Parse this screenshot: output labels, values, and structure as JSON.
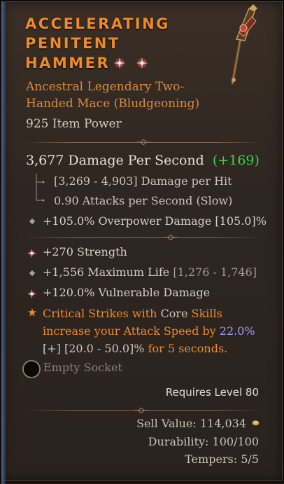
{
  "item": {
    "name_lines": [
      "Accelerating",
      "Penitent",
      "Hammer"
    ],
    "subtitle_lines": [
      "Ancestral Legendary Two-",
      "Handed Mace (Bludgeoning)"
    ],
    "item_power": "925 Item Power"
  },
  "damage": {
    "dps": "3,677 Damage Per Second",
    "dps_delta": "(+169)",
    "per_hit": "[3,269 - 4,903] Damage per Hit",
    "attacks": "0.90 Attacks per Second (Slow)",
    "overpower": "+105.0% Overpower Damage [105.0]%"
  },
  "affixes": {
    "strength": "+270 Strength",
    "life_value": "+1,556 Maximum Life",
    "life_range": "[1,276 - 1,746]",
    "vulnerable": "+120.0% Vulnerable Damage"
  },
  "legendary": {
    "part1": "Critical Strikes with",
    "core": "Core",
    "part2": "Skills",
    "line2a": "increase your Attack Speed by",
    "value": "22.0%",
    "range": "[+] [20.0 - 50.0]%",
    "line3b": "for 5 seconds."
  },
  "socket": {
    "label": "Empty Socket"
  },
  "requirements": {
    "level": "Requires Level 80"
  },
  "footer": {
    "sell_value": "Sell Value: 114,034",
    "durability": "Durability: 100/100",
    "tempers": "Tempers: 5/5"
  },
  "colors": {
    "legendary_orange": "#ef8a2a",
    "delta_green": "#36d64a",
    "value_blue": "#9aa2ff"
  },
  "icons": {
    "ancestral": "ancestral-star-icon",
    "affix_greater": "star-burst-icon",
    "affix_normal": "diamond-icon",
    "legendary_power": "orange-star-icon",
    "socket": "socket-ring-icon",
    "gold": "gold-coin-icon"
  }
}
